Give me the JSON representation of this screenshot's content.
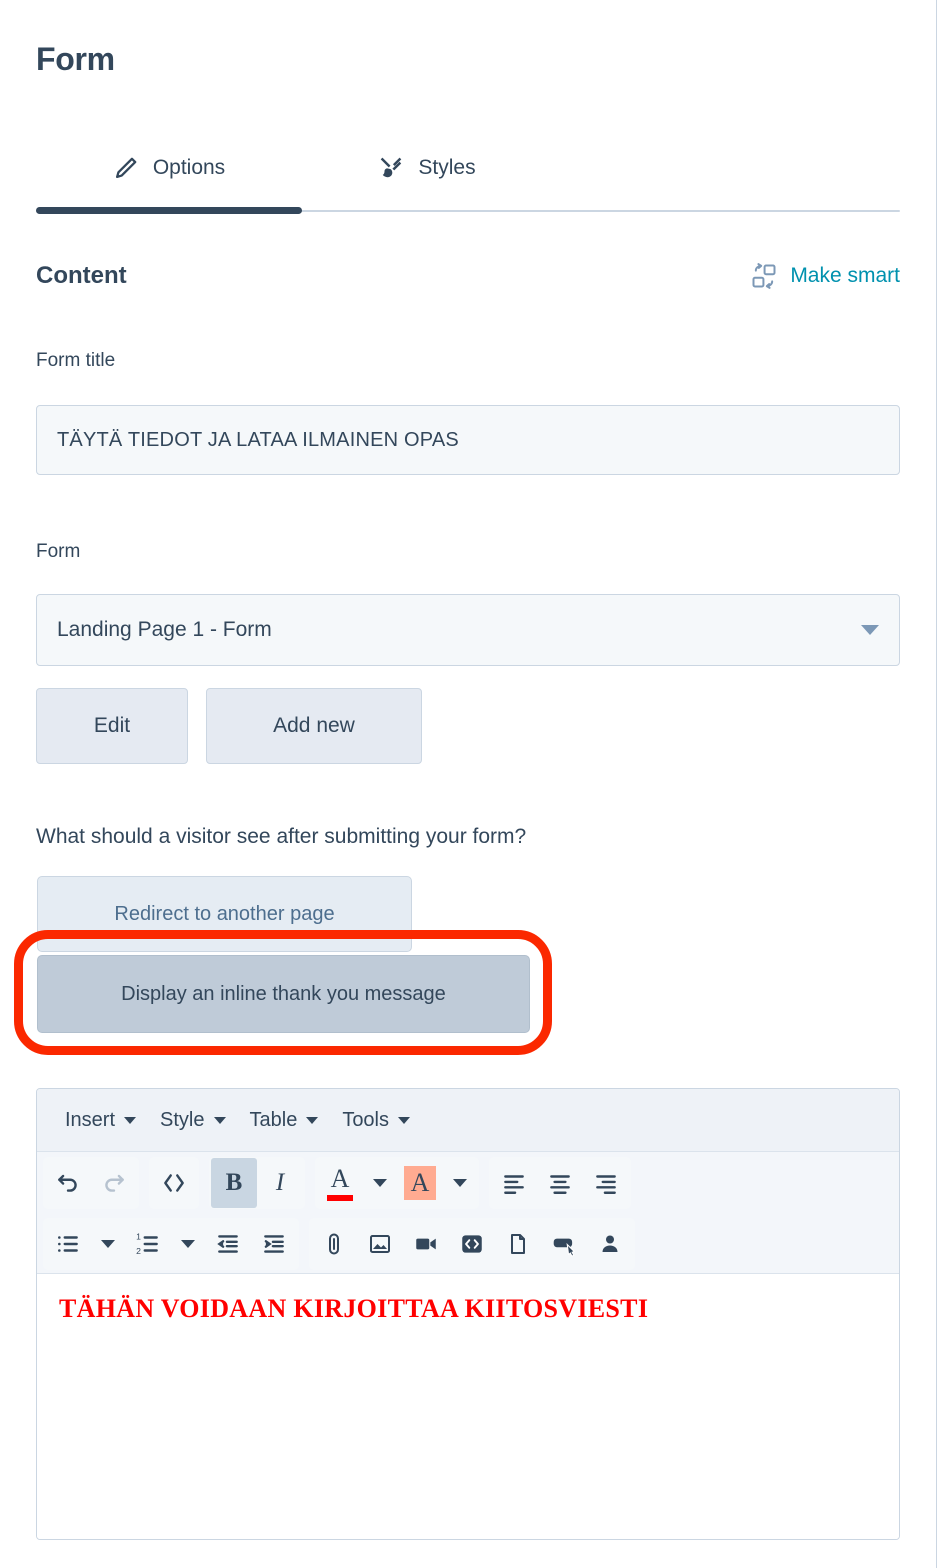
{
  "header": {
    "title": "Form"
  },
  "tabs": [
    {
      "label": "Options",
      "icon": "pencil-icon",
      "active": true
    },
    {
      "label": "Styles",
      "icon": "paintbrush-icon",
      "active": false
    }
  ],
  "content_section": {
    "title": "Content",
    "make_smart_label": "Make smart",
    "make_smart_icon": "smart-content-icon",
    "make_smart_color": "#0091ae"
  },
  "fields": {
    "form_title": {
      "label": "Form title",
      "value": "TÄYTÄ TIEDOT JA LATAA ILMAINEN OPAS",
      "placeholder": "Form title"
    },
    "form_select": {
      "label": "Form",
      "selected": "Landing Page 1 - Form",
      "caret_icon": "chevron-down-icon"
    },
    "form_buttons": {
      "edit": "Edit",
      "add_new": "Add new"
    }
  },
  "post_submit": {
    "question": "What should a visitor see after submitting your form?",
    "options": [
      {
        "label": "Redirect to another page",
        "selected": false
      },
      {
        "label": "Display an inline thank you message",
        "selected": true
      }
    ]
  },
  "annotation": {
    "shape": "rounded-rectangle",
    "color": "#fb2800",
    "targets": "Display an inline thank you message"
  },
  "editor": {
    "menu": [
      {
        "label": "Insert"
      },
      {
        "label": "Style"
      },
      {
        "label": "Table"
      },
      {
        "label": "Tools"
      }
    ],
    "toolbar_row1": [
      {
        "name": "undo-icon",
        "state": "enabled"
      },
      {
        "name": "redo-icon",
        "state": "disabled"
      },
      {
        "name": "source-code-icon",
        "state": "enabled"
      },
      {
        "name": "bold-icon",
        "state": "active",
        "glyph": "B"
      },
      {
        "name": "italic-icon",
        "state": "enabled",
        "glyph": "I"
      },
      {
        "name": "text-color-icon",
        "state": "enabled",
        "glyph": "A",
        "swatch": "#ff0000"
      },
      {
        "name": "text-color-dropdown-icon",
        "state": "enabled"
      },
      {
        "name": "highlight-color-icon",
        "state": "enabled",
        "glyph": "A",
        "swatch": "#ffab91"
      },
      {
        "name": "highlight-color-dropdown-icon",
        "state": "enabled"
      },
      {
        "name": "align-left-icon",
        "state": "enabled"
      },
      {
        "name": "align-center-icon",
        "state": "enabled"
      },
      {
        "name": "align-right-icon",
        "state": "enabled"
      }
    ],
    "toolbar_row2": [
      {
        "name": "bullet-list-icon"
      },
      {
        "name": "bullet-list-dropdown-icon"
      },
      {
        "name": "numbered-list-icon"
      },
      {
        "name": "numbered-list-dropdown-icon"
      },
      {
        "name": "outdent-icon"
      },
      {
        "name": "indent-icon"
      },
      {
        "name": "link-icon"
      },
      {
        "name": "image-icon"
      },
      {
        "name": "video-icon"
      },
      {
        "name": "embed-code-icon"
      },
      {
        "name": "file-icon"
      },
      {
        "name": "cta-button-icon"
      },
      {
        "name": "personalize-icon"
      }
    ],
    "body_text": "TÄHÄN VOIDAAN KIRJOITTAA KIITOSVIESTI",
    "body_text_color": "#ff0000"
  },
  "colors": {
    "ink": "#33475b",
    "accent_teal": "#0091ae",
    "field_bg": "#f5f8fa",
    "border": "#cbd6e2",
    "annotation_red": "#fb2800"
  }
}
